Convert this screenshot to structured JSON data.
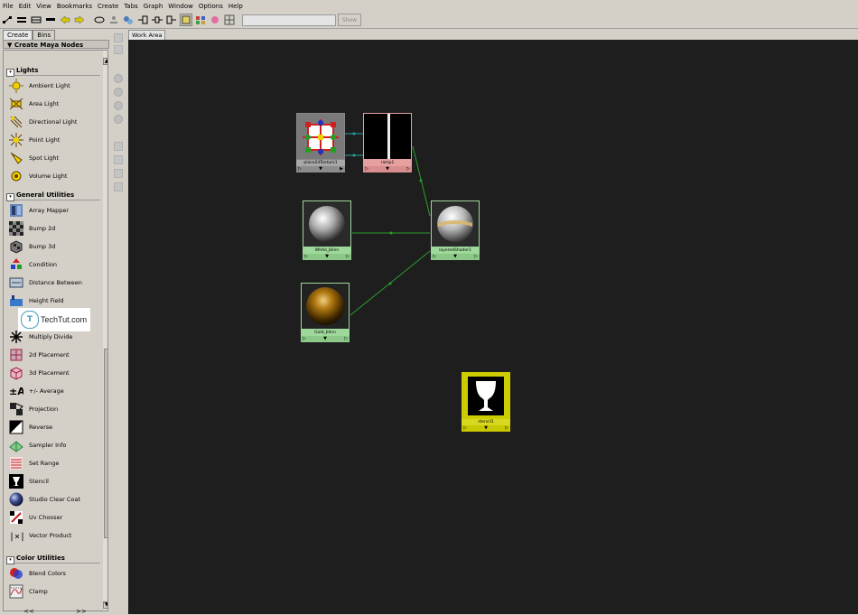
{
  "menu": [
    "File",
    "Edit",
    "View",
    "Bookmarks",
    "Create",
    "Tabs",
    "Graph",
    "Window",
    "Options",
    "Help"
  ],
  "toolbar": {
    "show_label": "Show"
  },
  "left_tabs": [
    "Create",
    "Bins"
  ],
  "create_header": "Create Maya Nodes",
  "sections": {
    "lights": {
      "title": "Lights",
      "items": [
        "Ambient Light",
        "Area Light",
        "Directional Light",
        "Point Light",
        "Spot Light",
        "Volume Light"
      ]
    },
    "general": {
      "title": "General Utilities",
      "items": [
        "Array Mapper",
        "Bump 2d",
        "Bump 3d",
        "Condition",
        "Distance Between",
        "Height Field",
        "",
        "Multiply Divide",
        "2d Placement",
        "3d Placement",
        "+/- Average",
        "Projection",
        "Reverse",
        "Sampler Info",
        "Set Range",
        "Stencil",
        "Studio Clear Coat",
        "Uv Chooser",
        "Vector Product"
      ]
    },
    "color": {
      "title": "Color Utilities",
      "items": [
        "Blend Colors",
        "Clamp"
      ]
    }
  },
  "bottom_nav": [
    "<<",
    ">>"
  ],
  "work_area_tab": "Work Area",
  "nodes": {
    "place2d": "place2dTexture1",
    "ramp": "ramp1",
    "white": "White_blinn",
    "layered": "layeredShader1",
    "gold": "Gold_blinn",
    "stencil": "stencil1"
  },
  "watermark": {
    "letter": "T",
    "text": "TechTut.com"
  },
  "colors": {
    "work_bg": "#1e1e1e",
    "connection": "#2aa02a",
    "node_green": "#9ed89a",
    "node_pink": "#e6a0a0",
    "node_yellow": "#cccc00"
  }
}
